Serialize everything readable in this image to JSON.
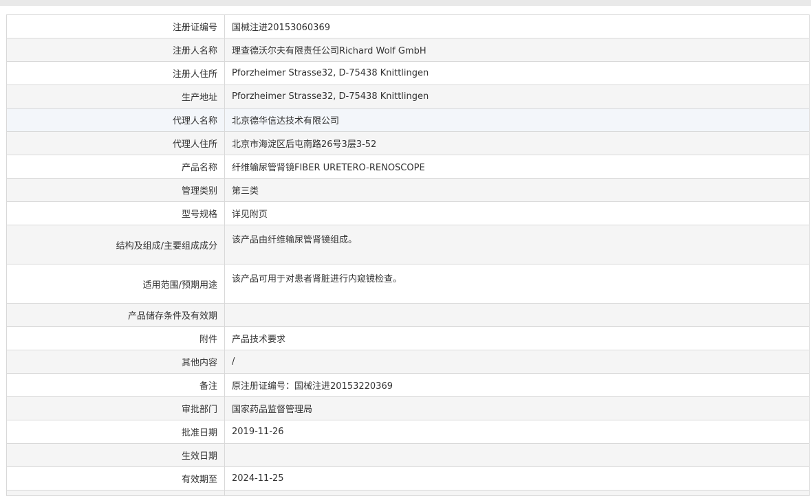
{
  "rows": [
    {
      "label": "注册证编号",
      "value": "国械注进20153060369"
    },
    {
      "label": "注册人名称",
      "value": "理查德沃尔夫有限责任公司Richard Wolf GmbH"
    },
    {
      "label": "注册人住所",
      "value": "Pforzheimer Strasse32, D-75438 Knittlingen"
    },
    {
      "label": "生产地址",
      "value": "Pforzheimer Strasse32, D-75438 Knittlingen"
    },
    {
      "label": "代理人名称",
      "value": "北京德华信达技术有限公司"
    },
    {
      "label": "代理人住所",
      "value": "北京市海淀区后屯南路26号3层3-52"
    },
    {
      "label": "产品名称",
      "value": "纤维输尿管肾镜FIBER URETERO-RENOSCOPE"
    },
    {
      "label": "管理类别",
      "value": "第三类"
    },
    {
      "label": "型号规格",
      "value": "详见附页"
    },
    {
      "label": "结构及组成/主要组成成分",
      "value": "该产品由纤维输尿管肾镜组成。"
    },
    {
      "label": "适用范围/预期用途",
      "value": "该产品可用于对患者肾脏进行内窥镜检查。"
    },
    {
      "label": "产品储存条件及有效期",
      "value": ""
    },
    {
      "label": "附件",
      "value": "产品技术要求"
    },
    {
      "label": "其他内容",
      "value": "/"
    },
    {
      "label": "备注",
      "value": "原注册证编号：国械注进20153220369"
    },
    {
      "label": "审批部门",
      "value": "国家药品监督管理局"
    },
    {
      "label": "批准日期",
      "value": "2019-11-26"
    },
    {
      "label": "生效日期",
      "value": ""
    },
    {
      "label": "有效期至",
      "value": "2024-11-25"
    }
  ],
  "colors": {
    "border": "#d9d9d9",
    "row_alt": "#f5f5f5",
    "row_highlight": "#f3f6fa",
    "text": "#333333"
  }
}
